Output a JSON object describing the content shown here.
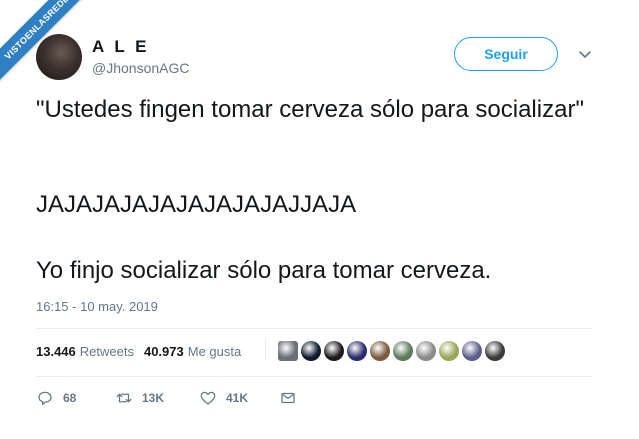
{
  "watermark": "VISTOENLASREDES",
  "author": {
    "name": "A L E",
    "handle": "@JhonsonAGC"
  },
  "follow_label": "Seguir",
  "tweet": {
    "line1": "\"Ustedes fingen tomar cerveza sólo para socializar\"",
    "line2": "JAJAJAJAJAJAJAJAJAJJAJA",
    "line3": "Yo finjo socializar sólo para tomar cerveza."
  },
  "timestamp": "16:15 - 10 may. 2019",
  "stats": {
    "retweets_count": "13.446",
    "retweets_label": "Retweets",
    "likes_count": "40.973",
    "likes_label": "Me gusta"
  },
  "likers_colors": [
    "#6d6f78",
    "#0f1a2e",
    "#1a1a1a",
    "#2a2c6b",
    "#7a5a3a",
    "#5c7a5c",
    "#8a8a8a",
    "#9aa55a",
    "#5b5f8a",
    "#3a3a3a"
  ],
  "actions": {
    "reply_count": "68",
    "retweet_count": "13K",
    "like_count": "41K"
  },
  "colors": {
    "accent": "#1da1f2",
    "muted": "#657786",
    "text": "#14171a"
  }
}
